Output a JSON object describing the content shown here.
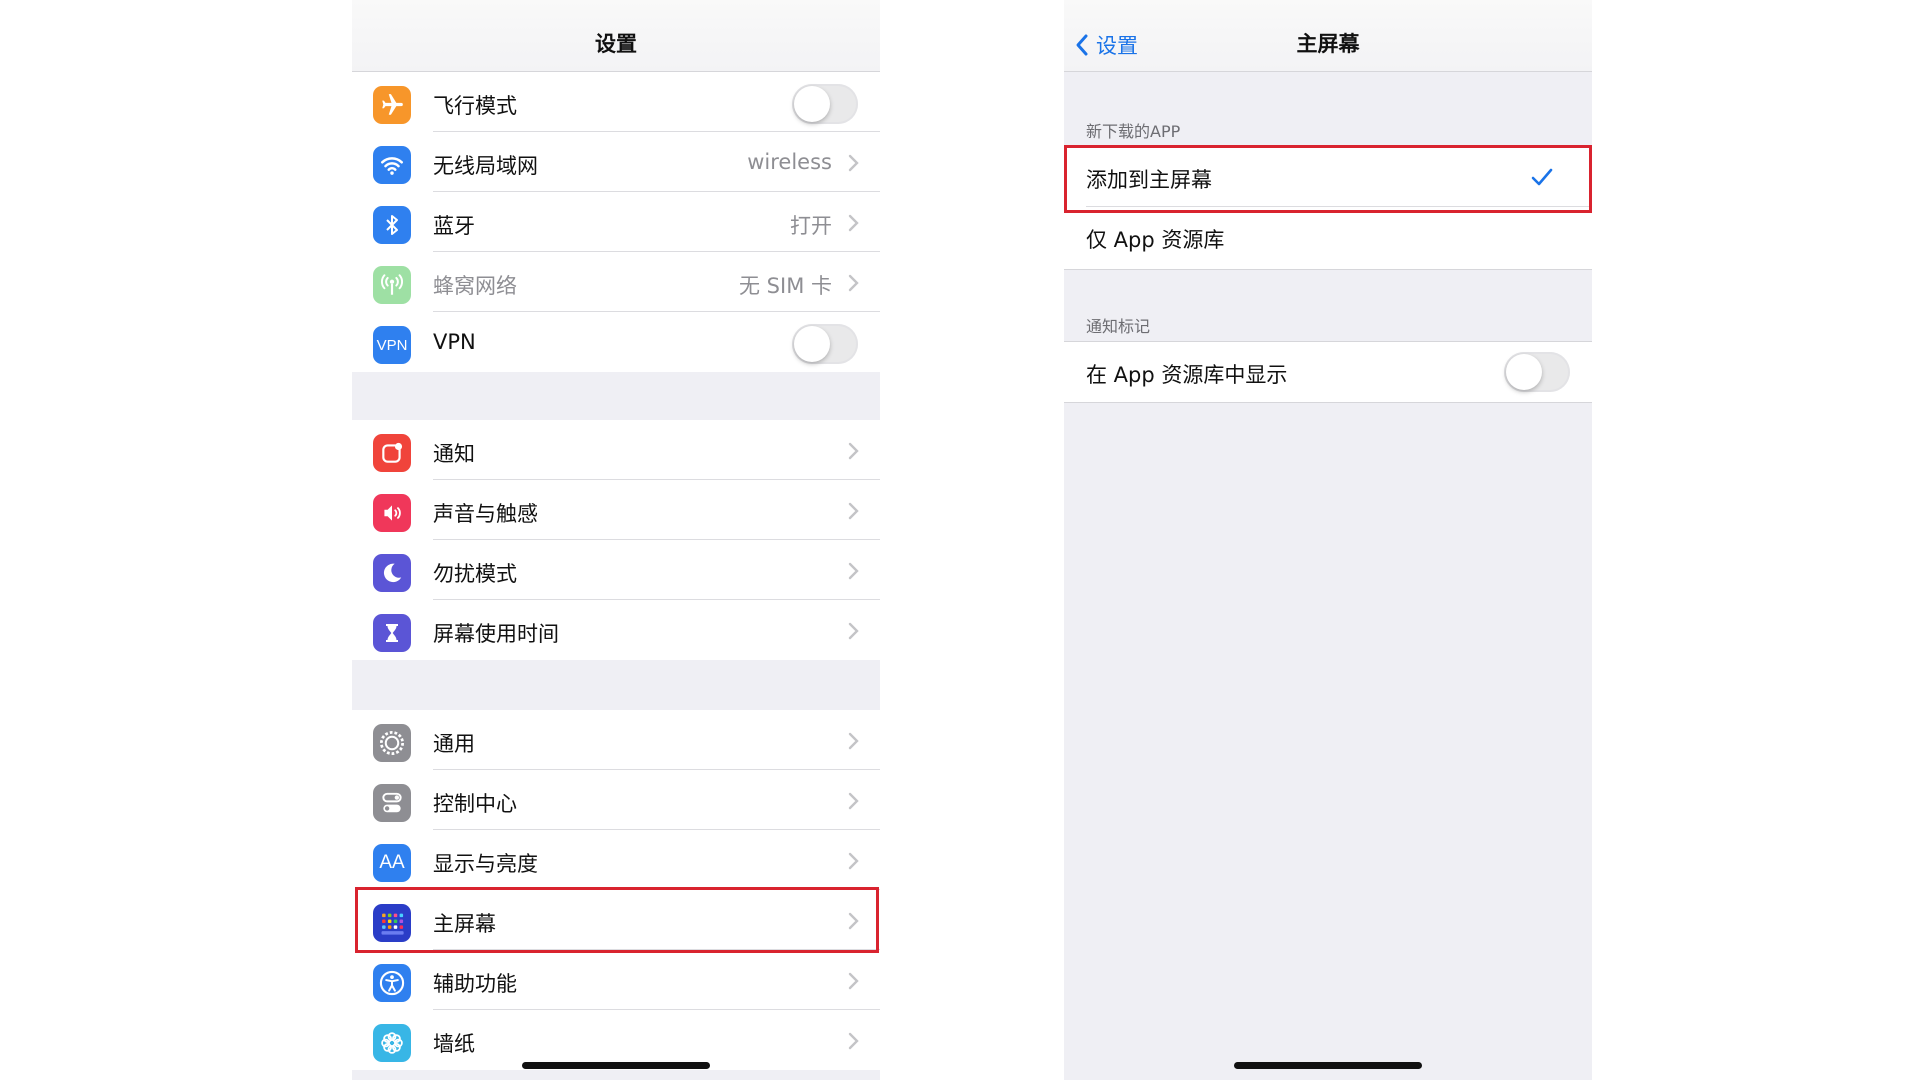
{
  "left_screen": {
    "title": "设置",
    "group1": [
      {
        "label": "飞行模式",
        "icon": "airplane-icon",
        "color": "#f7962a",
        "toggle": "off"
      },
      {
        "label": "无线局域网",
        "value": "wireless",
        "icon": "wifi-icon",
        "color": "#2f80ef"
      },
      {
        "label": "蓝牙",
        "value": "打开",
        "icon": "bluetooth-icon",
        "color": "#2f80ef"
      },
      {
        "label": "蜂窝网络",
        "value": "无 SIM 卡",
        "icon": "antenna-icon",
        "color": "#9ee0a4",
        "dimmed": true
      },
      {
        "label": "VPN",
        "icon": "vpn-icon",
        "icon_text": "VPN",
        "color": "#2f80ef",
        "toggle": "off"
      }
    ],
    "group2": [
      {
        "label": "通知",
        "icon": "notification-icon",
        "color": "#f0443b"
      },
      {
        "label": "声音与触感",
        "icon": "speaker-icon",
        "color": "#f0375a"
      },
      {
        "label": "勿扰模式",
        "icon": "moon-icon",
        "color": "#5b55d6"
      },
      {
        "label": "屏幕使用时间",
        "icon": "hourglass-icon",
        "color": "#5b55d6"
      }
    ],
    "group3": [
      {
        "label": "通用",
        "icon": "gear-icon",
        "color": "#8e8e93"
      },
      {
        "label": "控制中心",
        "icon": "switches-icon",
        "color": "#8e8e93"
      },
      {
        "label": "显示与亮度",
        "icon": "text-size-icon",
        "icon_text": "AA",
        "color": "#2f80ef"
      },
      {
        "label": "主屏幕",
        "icon": "home-screen-icon",
        "color": "#2a3dc7",
        "highlighted": true
      },
      {
        "label": "辅助功能",
        "icon": "accessibility-icon",
        "color": "#2f80ef"
      },
      {
        "label": "墙纸",
        "icon": "flower-icon",
        "color": "#38b6e6"
      }
    ]
  },
  "right_screen": {
    "back_label": "设置",
    "title": "主屏幕",
    "section1_header": "新下载的APP",
    "section1_options": [
      {
        "label": "添加到主屏幕",
        "selected": true
      },
      {
        "label": "仅 App 资源库",
        "selected": false
      }
    ],
    "section2_header": "通知标记",
    "section2_row": {
      "label": "在 App 资源库中显示",
      "toggle": "off"
    }
  },
  "colors": {
    "highlight_border": "#d9232f",
    "accent": "#1a73e8"
  }
}
